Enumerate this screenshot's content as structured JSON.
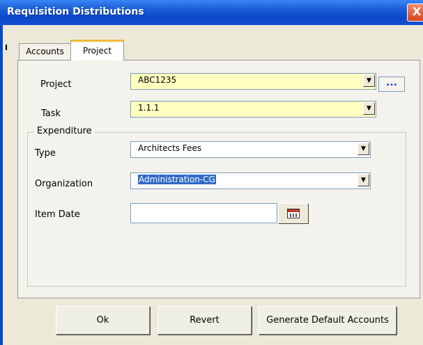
{
  "window": {
    "title": "Requisition Distributions",
    "close_glyph": "X"
  },
  "tabs": [
    {
      "label": "Accounts",
      "selected": false
    },
    {
      "label": "Project",
      "selected": true
    }
  ],
  "project": {
    "project_label": "Project",
    "project_value": "ABC1235",
    "lov_label": "...",
    "task_label": "Task",
    "task_value": "1.1.1"
  },
  "expenditure": {
    "group_label": "Expenditure",
    "type_label": "Type",
    "type_value": "Architects Fees",
    "organization_label": "Organization",
    "organization_value": "Administration-CG",
    "item_date_label": "Item Date",
    "item_date_value": ""
  },
  "buttons": {
    "ok": "Ok",
    "revert": "Revert",
    "generate": "Generate Default Accounts"
  },
  "icons": {
    "dropdown_arrow": "▼",
    "calendar": "calendar-icon"
  },
  "colors": {
    "title_bar": "#0a48c9",
    "required_field": "#ffffc0",
    "selection": "#316ac5"
  }
}
